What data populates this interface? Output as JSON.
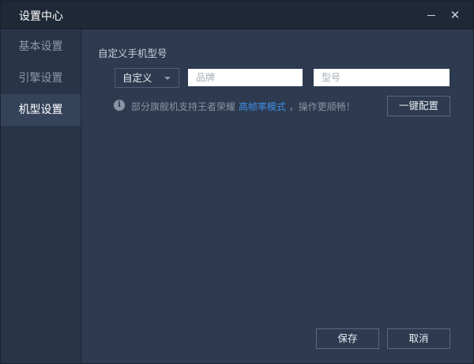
{
  "window": {
    "title": "设置中心"
  },
  "sidebar": {
    "items": [
      {
        "label": "基本设置"
      },
      {
        "label": "引擎设置"
      },
      {
        "label": "机型设置"
      }
    ]
  },
  "main": {
    "section_title": "自定义手机型号",
    "device_select": {
      "value": "自定义"
    },
    "brand_input": {
      "placeholder": "品牌"
    },
    "model_input": {
      "placeholder": "型号"
    },
    "info": {
      "prefix": "部分旗舰机支持王者荣耀",
      "link": "高帧率模式",
      "suffix": "，操作更顺畅！"
    },
    "one_click_button": "一键配置"
  },
  "footer": {
    "save_label": "保存",
    "cancel_label": "取消"
  }
}
